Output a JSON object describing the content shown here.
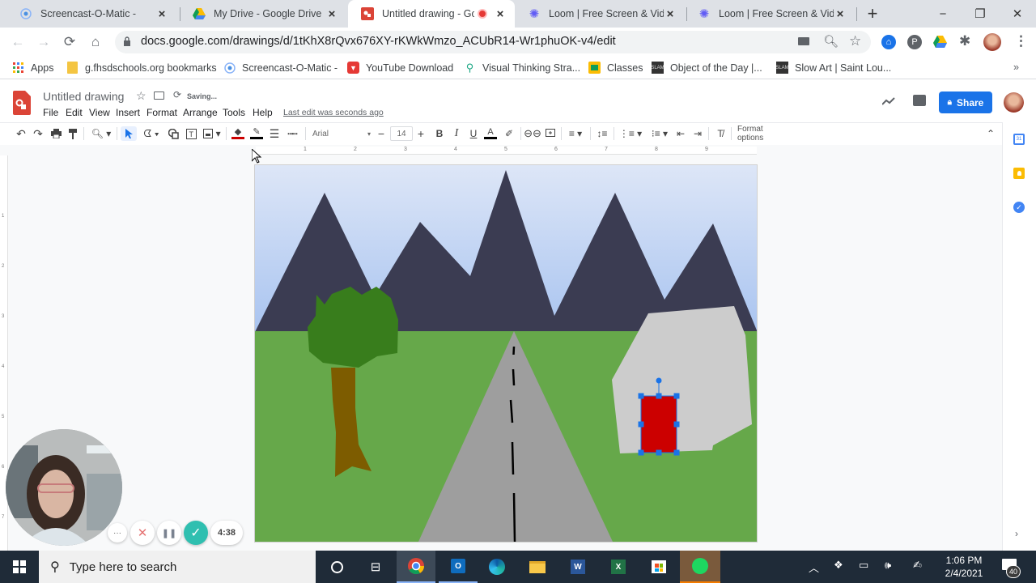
{
  "browser": {
    "tabs": [
      {
        "label": "Screencast-O-Matic -",
        "icon": "screencast-icon",
        "active": false
      },
      {
        "label": "My Drive - Google Drive",
        "icon": "google-drive-icon",
        "active": false
      },
      {
        "label": "Untitled drawing - Goo",
        "icon": "google-drawings-icon",
        "active": true,
        "recording": true
      },
      {
        "label": "Loom | Free Screen & Vide",
        "icon": "loom-icon",
        "active": false
      },
      {
        "label": "Loom | Free Screen & Vide",
        "icon": "loom-icon",
        "active": false
      }
    ],
    "new_tab": "+",
    "window": {
      "minimize": "−",
      "restore": "❐",
      "close": "✕"
    },
    "url": "docs.google.com/drawings/d/1tKhX8rQvx676XY-rKWkWmzo_ACUbR14-Wr1phuOK-v4/edit",
    "bookmarks": [
      {
        "label": "Apps",
        "icon": "apps-grid-icon"
      },
      {
        "label": "g.fhsdschools.org bookmarks",
        "icon": "folder-icon"
      },
      {
        "label": "Screencast-O-Matic -",
        "icon": "screencast-icon"
      },
      {
        "label": "YouTube Download",
        "icon": "youtube-download-icon"
      },
      {
        "label": "Visual Thinking Stra...",
        "icon": "visual-thinking-icon"
      },
      {
        "label": "Classes",
        "icon": "classroom-icon"
      },
      {
        "label": "Object of the Day |...",
        "icon": "slam-icon"
      },
      {
        "label": "Slow Art | Saint Lou...",
        "icon": "slam-icon"
      }
    ],
    "bookmarks_overflow": "»"
  },
  "docs": {
    "title": "Untitled drawing",
    "save_status": "Saving...",
    "menu": [
      "File",
      "Edit",
      "View",
      "Insert",
      "Format",
      "Arrange",
      "Tools",
      "Help"
    ],
    "last_edit": "Last edit was seconds ago",
    "share_label": "Share",
    "toolbar": {
      "font": "Arial",
      "font_size": "14",
      "format_options": "Format options",
      "fill_color": "#cc0000",
      "line_color": "#000000"
    },
    "ruler_numbers": [
      "1",
      "2",
      "3",
      "4",
      "5",
      "6",
      "7",
      "8",
      "9"
    ],
    "vruler_numbers": [
      "1",
      "2",
      "3",
      "4",
      "5",
      "6",
      "7"
    ]
  },
  "drawing": {
    "colors": {
      "sky_top": "#dde6f7",
      "sky_bottom": "#a9c4f0",
      "mountain": "#3b3c52",
      "grass": "#66a84a",
      "tree_top": "#387d1c",
      "trunk": "#7d5c00",
      "road": "#9e9e9e",
      "road_line": "#000000",
      "house": "#cccccc",
      "door": "#cc0000",
      "selection": "#1a73e8"
    }
  },
  "loom": {
    "timer": "4:38",
    "more": "···",
    "cancel": "✕",
    "pause": "❚❚",
    "done": "✓"
  },
  "taskbar": {
    "search_placeholder": "Type here to search",
    "time": "1:06 PM",
    "date": "2/4/2021",
    "notifications": "40"
  }
}
